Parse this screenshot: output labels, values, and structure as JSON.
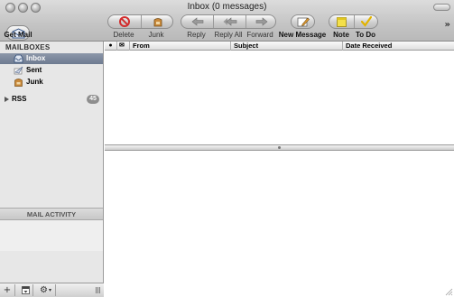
{
  "window": {
    "title": "Inbox (0 messages)"
  },
  "toolbar": {
    "get_mail": "Get Mail",
    "delete": "Delete",
    "junk": "Junk",
    "reply": "Reply",
    "reply_all": "Reply All",
    "forward": "Forward",
    "new_message": "New Message",
    "note": "Note",
    "to_do": "To Do",
    "overflow": "»"
  },
  "sidebar": {
    "heading": "MAILBOXES",
    "items": [
      {
        "label": "Inbox",
        "icon": "inbox-tray-icon",
        "selected": true
      },
      {
        "label": "Sent",
        "icon": "sent-paper-plane-icon",
        "selected": false
      },
      {
        "label": "Junk",
        "icon": "junk-bag-icon",
        "selected": false
      }
    ],
    "rss": {
      "label": "RSS",
      "count": "45"
    },
    "activity_heading": "MAIL ACTIVITY",
    "bottom_buttons": {
      "add": "+",
      "gear": "⚙"
    }
  },
  "message_list": {
    "columns": [
      "●",
      "✉",
      "From",
      "Subject",
      "Date Received"
    ]
  },
  "colors": {
    "selection": "#7a8599",
    "delete_red": "#d22d2d",
    "junk_brown": "#b4772a",
    "note_yellow": "#f4e04a",
    "todo_check": "#e2b400"
  }
}
